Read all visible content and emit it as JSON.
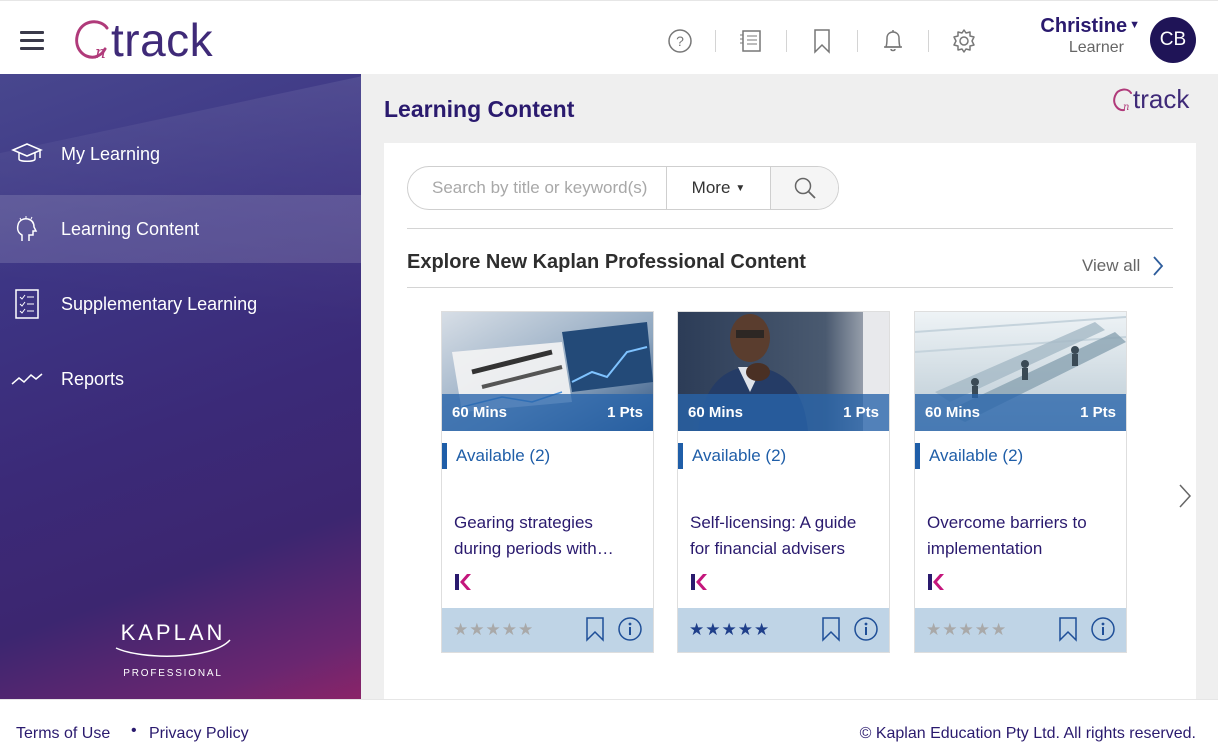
{
  "header": {
    "logo_text": "track",
    "user_name": "Christine",
    "user_role": "Learner",
    "avatar_initials": "CB",
    "icons": [
      "help-icon",
      "document-list-icon",
      "bookmark-icon",
      "bell-icon",
      "gear-icon"
    ]
  },
  "sidebar": {
    "items": [
      {
        "label": "My Learning",
        "icon": "graduation-cap-icon"
      },
      {
        "label": "Learning Content",
        "icon": "head-lightbulb-icon"
      },
      {
        "label": "Supplementary Learning",
        "icon": "checklist-icon"
      },
      {
        "label": "Reports",
        "icon": "trend-line-icon"
      }
    ],
    "active_index": 1,
    "brand": {
      "name": "KAPLAN",
      "sub": "PROFESSIONAL"
    }
  },
  "main": {
    "title": "Learning Content",
    "mini_logo_text": "track",
    "search": {
      "placeholder": "Search by title or keyword(s)",
      "more_label": "More"
    },
    "section": {
      "title": "Explore New Kaplan Professional Content",
      "view_all": "View all"
    },
    "cards": [
      {
        "duration": "60 Mins",
        "points": "1 Pts",
        "availability": "Available (2)",
        "title": "Gearing strategies during periods with…",
        "rating": 0
      },
      {
        "duration": "60 Mins",
        "points": "1 Pts",
        "availability": "Available (2)",
        "title": "Self-licensing: A guide for financial advisers",
        "rating": 5
      },
      {
        "duration": "60 Mins",
        "points": "1 Pts",
        "availability": "Available (2)",
        "title": "Overcome barriers to implementation",
        "rating": 0
      }
    ],
    "stars_text": "★★★★★"
  },
  "footer": {
    "terms": "Terms of Use",
    "bullet": "•",
    "privacy": "Privacy Policy",
    "copyright": "© Kaplan Education Pty Ltd. All rights reserved."
  },
  "colors": {
    "brand_purple": "#2a1a6e",
    "accent_blue": "#1f5ea8",
    "card_footer": "#bfd4e6",
    "kaplan_pink": "#c4167c"
  }
}
